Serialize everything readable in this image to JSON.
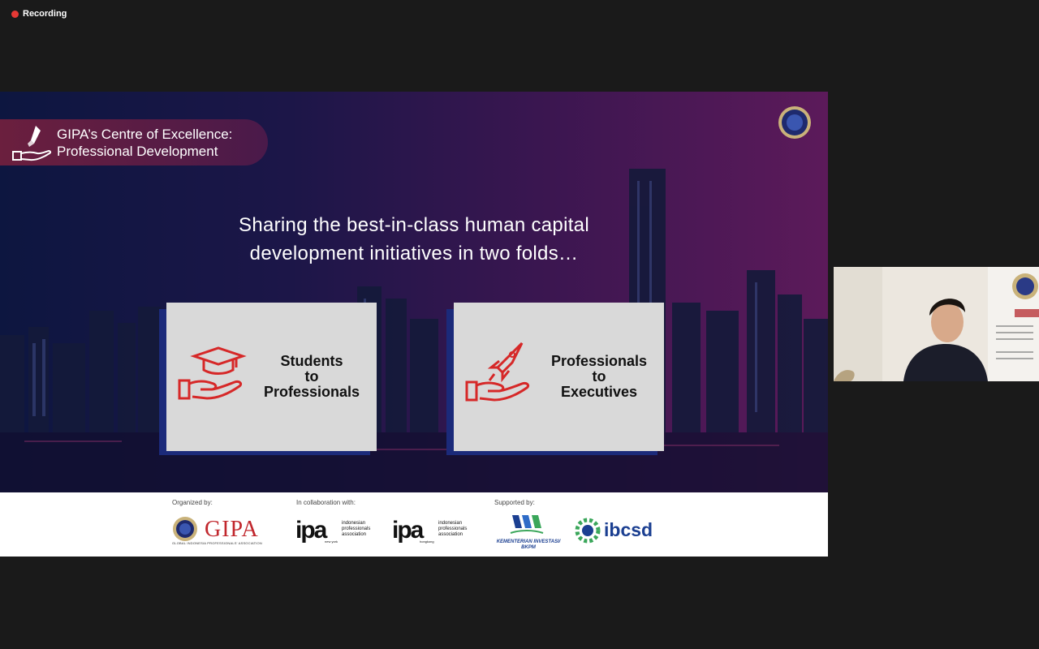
{
  "recording": {
    "label": "Recording"
  },
  "slide": {
    "badge": {
      "line1": "GIPA’s Centre of Excellence:",
      "line2": "Professional Development"
    },
    "headline": {
      "line1": "Sharing the best-in-class human capital",
      "line2": "development initiatives in two folds…"
    },
    "cards": [
      {
        "line1": "Students",
        "line2": "to",
        "line3": "Professionals",
        "icon": "graduation-cap-hand-icon"
      },
      {
        "line1": "Professionals",
        "line2": "to",
        "line3": "Executives",
        "icon": "rocket-hand-icon"
      }
    ],
    "footer": {
      "organized_by": "Organized by:",
      "collab": "In collaboration with:",
      "supported_by": "Supported by:",
      "gipa_word": "GIPA",
      "gipa_sub": "GLOBAL INDONESIA PROFESSIONALS' ASSOCIATION",
      "ipa_word": "ipa",
      "ipa_desc": "indonesian professionals association",
      "ipa1_loc": "new york",
      "ipa2_loc": "hongkong",
      "kementerian": "KEMENTERIAN INVESTASI/ BKPM",
      "ibcsd": "ibcsd"
    }
  },
  "colors": {
    "accent_red": "#d62828",
    "card_bg": "#d9d9d9",
    "card_shadow": "#1b2a7a",
    "badge": "#6b1f3e"
  }
}
